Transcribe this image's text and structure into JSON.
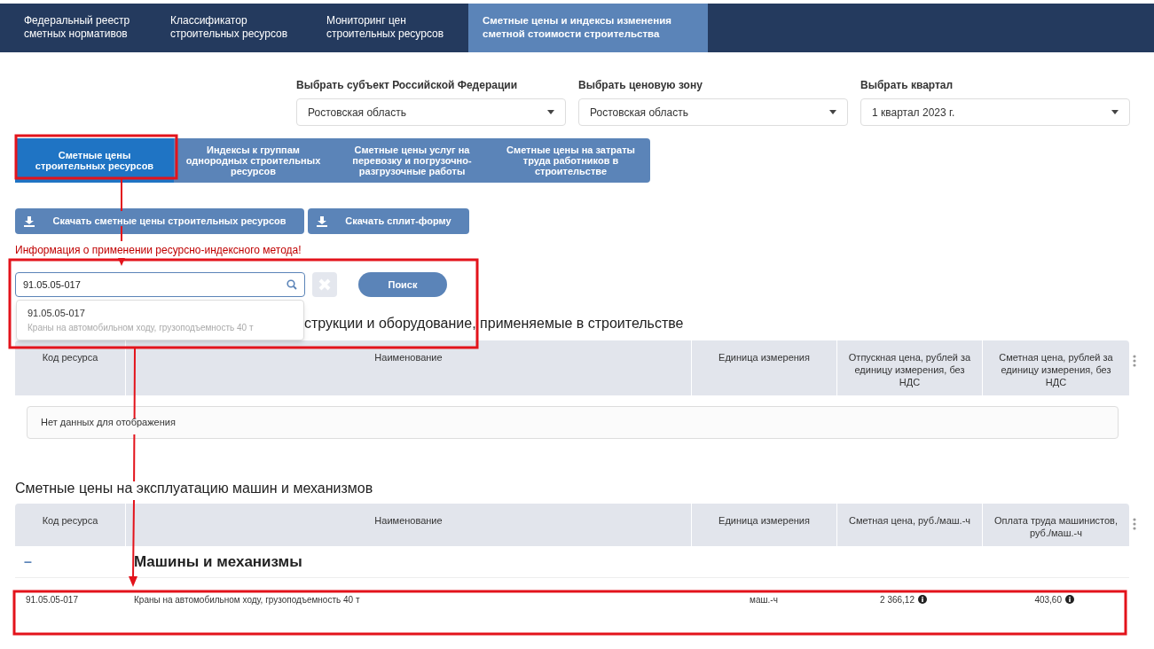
{
  "nav": [
    {
      "label": "Федеральный реестр сметных нормативов",
      "selected": false
    },
    {
      "label": "Классификатор строительных ресурсов",
      "selected": false
    },
    {
      "label": "Мониторинг цен строительных ресурсов",
      "selected": false
    },
    {
      "label": "Сметные цены и индексы изменения сметной стоимости строительства",
      "selected": true
    }
  ],
  "filters": [
    {
      "label": "Выбрать субъект Российской Федерации",
      "value": "Ростовская область"
    },
    {
      "label": "Выбрать ценовую зону",
      "value": "Ростовская область"
    },
    {
      "label": "Выбрать квартал",
      "value": "1 квартал 2023 г."
    }
  ],
  "subtabs": [
    {
      "label": "Сметные цены строительных ресурсов",
      "selected": true
    },
    {
      "label": "Индексы к группам однородных строительных ресурсов",
      "selected": false
    },
    {
      "label": "Сметные цены услуг на перевозку и погрузочно-разгрузочные работы",
      "selected": false
    },
    {
      "label": "Сметные цены на затраты труда работников в строительстве",
      "selected": false
    }
  ],
  "downloads": [
    "Скачать сметные цены строительных ресурсов",
    "Скачать сплит-форму"
  ],
  "info_link": "Информация о применении ресурсно-индексного метода!",
  "search": {
    "value": "91.05.05-017",
    "button": "Поиск"
  },
  "suggestions": [
    {
      "code": "91.05.05-017",
      "name": "Краны на автомобильном ходу, грузоподъемность 40 т"
    }
  ],
  "materials": {
    "title": "струкции и оборудование, применяемые в строительстве",
    "columns": [
      "Код ресурса",
      "Наименование",
      "Единица измерения",
      "Отпускная цена, рублей за единицу измерения, без НДС",
      "Сметная цена, рублей за единицу измерения, без НДС"
    ],
    "empty": "Нет данных для отображения"
  },
  "machines": {
    "title": "Сметные цены на эксплуатацию машин и механизмов",
    "columns": [
      "Код ресурса",
      "Наименование",
      "Единица измерения",
      "Сметная цена, руб./маш.-ч",
      "Оплата труда машинистов, руб./маш.-ч"
    ],
    "groups": [
      {
        "collapse": "–",
        "title": "Машины и механизмы",
        "expanded": true,
        "rows": [
          {
            "code": "91.05.05-017",
            "name": "Краны на автомобильном ходу, грузоподъемность 40 т",
            "unit": "маш.-ч",
            "price": "2 366,12",
            "wage": "403,60"
          }
        ]
      }
    ]
  }
}
